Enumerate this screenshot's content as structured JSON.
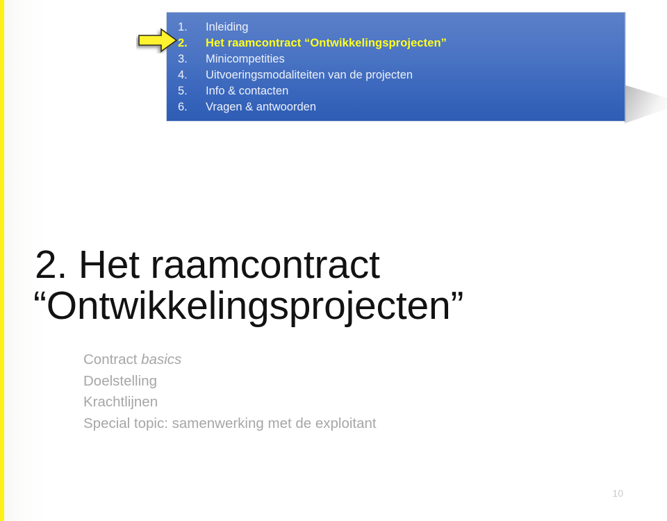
{
  "slide": {
    "accent_color": "#fff017",
    "box_color_top": "#5b80c9",
    "box_color_bottom": "#2f5cb4",
    "highlight_color": "#ffff1f",
    "page_number": "10"
  },
  "agenda": {
    "items": [
      {
        "number": "1.",
        "label": "Inleiding",
        "current": false
      },
      {
        "number": "2.",
        "label": "Het raamcontract “Ontwikkelingsprojecten”",
        "current": true
      },
      {
        "number": "3.",
        "label": "Minicompetities",
        "current": false
      },
      {
        "number": "4.",
        "label": "Uitvoeringsmodaliteiten van de projecten",
        "current": false
      },
      {
        "number": "5.",
        "label": "Info & contacten",
        "current": false
      },
      {
        "number": "6.",
        "label": "Vragen & antwoorden",
        "current": false
      }
    ]
  },
  "title": {
    "line1": "2. Het raamcontract",
    "line2": "“Ontwikkelingsprojecten”"
  },
  "subtopics": {
    "items": [
      {
        "text_plain": "Contract ",
        "text_italic": "basics"
      },
      {
        "text_plain": "Doelstelling",
        "text_italic": ""
      },
      {
        "text_plain": "Krachtlijnen",
        "text_italic": ""
      },
      {
        "text_plain": "Special topic: samenwerking met de exploitant",
        "text_italic": ""
      }
    ]
  }
}
